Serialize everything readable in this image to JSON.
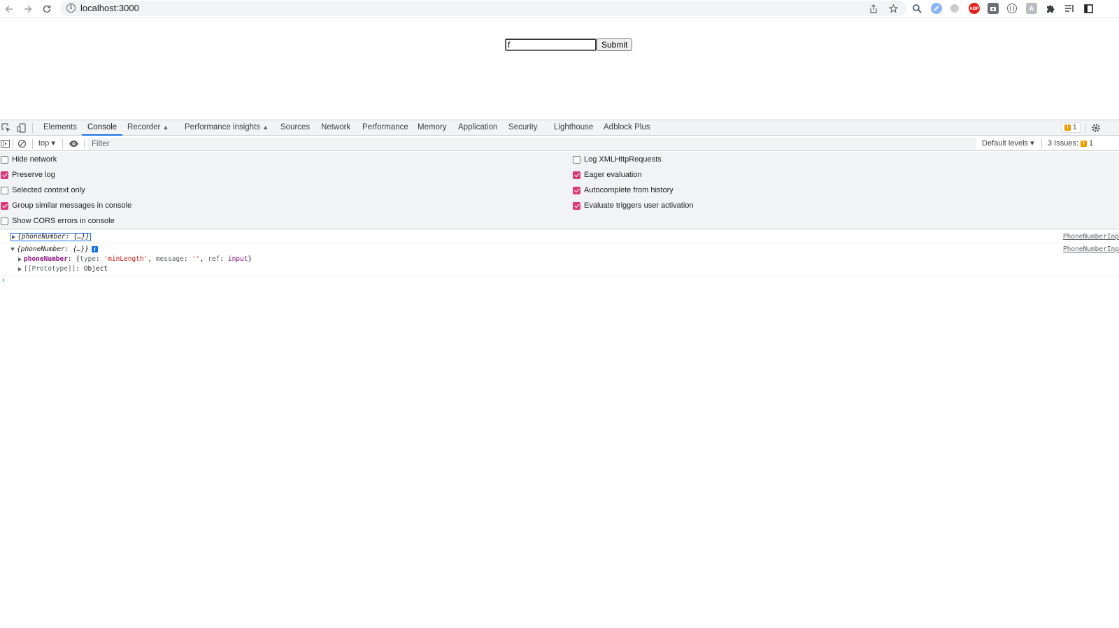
{
  "browser": {
    "url": "localhost:3000",
    "icons": [
      "back-arrow-icon",
      "forward-arrow-icon",
      "reload-icon",
      "info-icon",
      "share-icon",
      "bookmark-star-icon",
      "search-extension-icon",
      "extension-blue-icon",
      "extension-grey-icon",
      "adblock-icon",
      "camera-extension-icon",
      "code-extension-icon",
      "letter-extension-icon",
      "puzzle-icon",
      "reading-list-icon",
      "window-icon"
    ]
  },
  "page": {
    "input_value": "f",
    "submit_label": "Submit"
  },
  "devtools": {
    "tabs": [
      {
        "label": "Elements"
      },
      {
        "label": "Console",
        "active": true
      },
      {
        "label": "Recorder"
      },
      {
        "label": "Performance insights"
      },
      {
        "label": "Sources"
      },
      {
        "label": "Network"
      },
      {
        "label": "Performance"
      },
      {
        "label": "Memory"
      },
      {
        "label": "Application"
      },
      {
        "label": "Security"
      },
      {
        "label": "Lighthouse"
      },
      {
        "label": "Adblock Plus"
      }
    ],
    "tab_warning_count": "1",
    "context": "top",
    "filter_placeholder": "Filter",
    "levels_label": "Default levels",
    "issues_label": "3 Issues:",
    "issues_count": "1",
    "settings_left": [
      {
        "label": "Hide network",
        "checked": false
      },
      {
        "label": "Preserve log",
        "checked": true
      },
      {
        "label": "Selected context only",
        "checked": false
      },
      {
        "label": "Group similar messages in console",
        "checked": true
      },
      {
        "label": "Show CORS errors in console",
        "checked": false
      }
    ],
    "settings_right": [
      {
        "label": "Log XMLHttpRequests",
        "checked": false
      },
      {
        "label": "Eager evaluation",
        "checked": true
      },
      {
        "label": "Autocomplete from history",
        "checked": true
      },
      {
        "label": "Evaluate triggers user activation",
        "checked": true
      }
    ],
    "colors": {
      "accent": "#1a73e8",
      "checkbox": "#d93a7a",
      "warning": "#f29900"
    }
  },
  "console": {
    "msg1_preview": "{phoneNumber: {…}}",
    "msg1_source": "PhoneNumberInp",
    "msg2_preview": "{phoneNumber: {…}}",
    "msg2_source": "PhoneNumberInp",
    "prop_key": "phoneNumber",
    "prop_open": ": {",
    "type_key": "type",
    "type_val": "'minLength'",
    "message_key": "message",
    "message_val": "''",
    "ref_key": "ref",
    "ref_val": "input",
    "prop_close": "}",
    "proto_key": "[[Prototype]]",
    "proto_val": "Object",
    "prompt": "›"
  }
}
